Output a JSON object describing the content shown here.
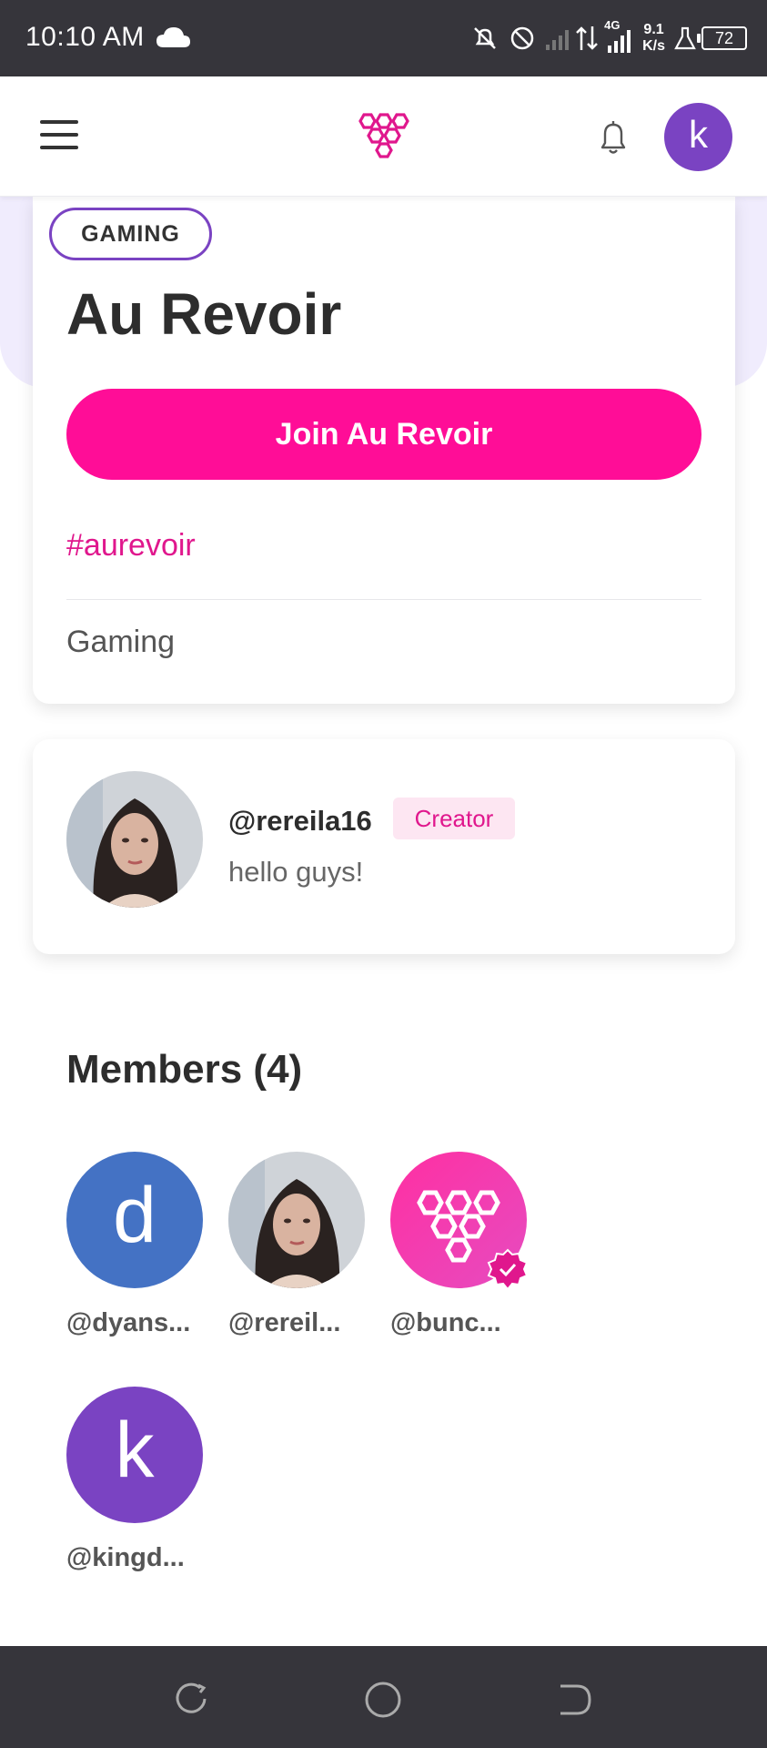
{
  "status_bar": {
    "time": "10:10 AM",
    "network_type": "4G",
    "speed_value": "9.1",
    "speed_unit": "K/s",
    "battery": "72"
  },
  "header": {
    "menu_icon": "hamburger-menu-icon",
    "logo_icon": "honeycomb-logo-icon",
    "notification_icon": "bell-icon",
    "user_avatar_letter": "k"
  },
  "group": {
    "category_chip": "GAMING",
    "title": "Au Revoir",
    "join_button": "Join Au Revoir",
    "hashtag": "#aurevoir",
    "category": "Gaming"
  },
  "creator_post": {
    "handle": "@rereila16",
    "badge": "Creator",
    "status": "hello guys!"
  },
  "members": {
    "title": "Members (4)",
    "list": [
      {
        "name": "@dyans...",
        "avatar_letter": "d",
        "avatar_color": "#4472c4"
      },
      {
        "name": "@rereil...",
        "avatar_type": "photo"
      },
      {
        "name": "@bunc...",
        "avatar_type": "honeycomb-logo",
        "verified": true
      },
      {
        "name": "@kingd...",
        "avatar_letter": "k",
        "avatar_color": "#7a43c2"
      }
    ]
  },
  "colors": {
    "brand_pink": "#ff0d97",
    "accent_purple": "#7a43c2",
    "lavender": "#f0ecfd"
  }
}
